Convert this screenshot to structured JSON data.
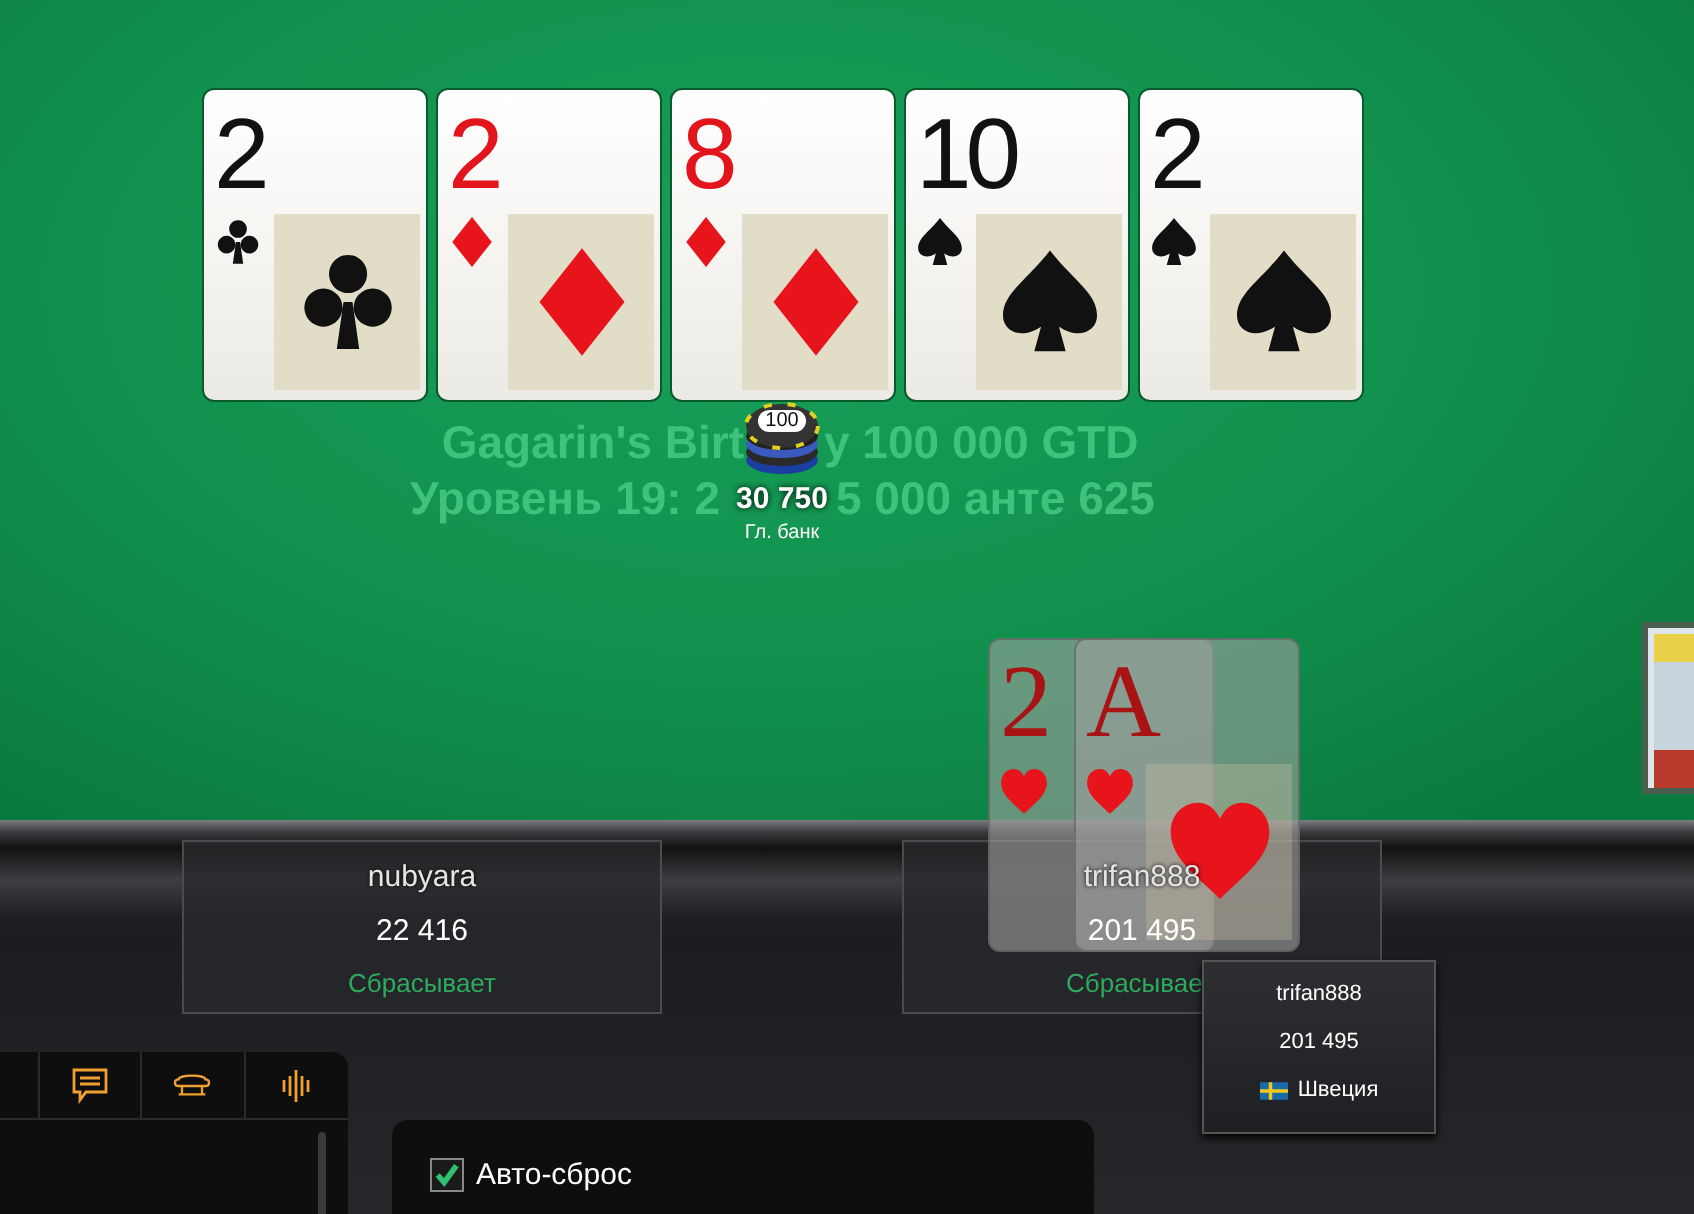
{
  "board_cards": [
    {
      "rank": "2",
      "kind": "clubs"
    },
    {
      "rank": "2",
      "kind": "diamonds"
    },
    {
      "rank": "8",
      "kind": "diamonds"
    },
    {
      "rank": "10",
      "kind": "spades"
    },
    {
      "rank": "2",
      "kind": "spades"
    }
  ],
  "table_info": [
    {
      "left": "Gagarin's Birt",
      "right": "y 100 000 GTD"
    },
    {
      "left": "Уровень 19: 2",
      "right": "5 000 анте 625"
    }
  ],
  "pot": {
    "chip": "100",
    "amount": "30 750",
    "label": "Гл. банк"
  },
  "seats": [
    {
      "name": "nubyara",
      "stack": "22 416",
      "action": "Сбрасывает"
    },
    {
      "name": "trifan888",
      "stack": "201 495",
      "action": "Сбрасывае"
    }
  ],
  "hole_cards": [
    {
      "rank": "2",
      "kind": "hearts"
    },
    {
      "rank": "A",
      "kind": "hearts"
    }
  ],
  "tooltip": {
    "name": "trifan888",
    "stack": "201 495",
    "country": "Швеция"
  },
  "panel_tabs": [
    {
      "kind": "chat"
    },
    {
      "kind": "table"
    },
    {
      "kind": "sound"
    }
  ],
  "options": [
    {
      "label": "Авто-сброс",
      "checked": true
    }
  ]
}
